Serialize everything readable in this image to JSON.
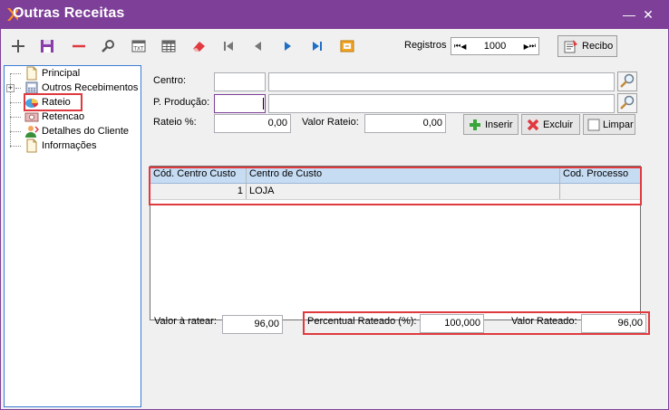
{
  "window": {
    "title": "Outras Receitas",
    "accent": "#7d3f98",
    "minimize_glyph": "—",
    "close_glyph": "✕"
  },
  "toolbar": {
    "buttons": [
      "add-icon",
      "save-icon",
      "delete-icon",
      "search-icon",
      "export-txt-icon",
      "grid-icon",
      "eraser-icon",
      "first-record-icon",
      "previous-record-icon",
      "next-record-icon",
      "last-record-icon",
      "exit-icon"
    ],
    "registros_label": "Registros",
    "registros_value": "1000",
    "recibo_label": "Recibo"
  },
  "tree": {
    "items": [
      {
        "label": "Principal",
        "icon": "document-icon"
      },
      {
        "label": "Outros Recebimentos",
        "icon": "calculator-icon",
        "expandable": true,
        "expander": "+"
      },
      {
        "label": "Rateio",
        "icon": "pie-chart-icon",
        "selected": true
      },
      {
        "label": "Retencao",
        "icon": "money-icon"
      },
      {
        "label": "Detalhes do Cliente",
        "icon": "user-icon"
      },
      {
        "label": "Informações",
        "icon": "document-icon"
      }
    ]
  },
  "form": {
    "centro_label": "Centro:",
    "centro_code": "",
    "centro_desc": "",
    "producao_label": "P. Produção:",
    "producao_code": "",
    "producao_desc": "",
    "rateio_pct_label": "Rateio %:",
    "rateio_pct_value": "0,00",
    "valor_rateio_label": "Valor Rateio:",
    "valor_rateio_value": "0,00",
    "inserir_label": "Inserir",
    "excluir_label": "Excluir",
    "limpar_label": "Limpar"
  },
  "grid": {
    "columns": [
      "Cód. Centro Custo",
      "Centro de Custo",
      "Cod. Processo"
    ],
    "rows": [
      {
        "codigo": "1",
        "centro": "LOJA",
        "processo": ""
      }
    ]
  },
  "footer": {
    "valor_ratear_label": "Valor à ratear:",
    "valor_ratear_value": "96,00",
    "percentual_label": "Percentual Rateado (%):",
    "percentual_value": "100,000",
    "valor_rateado_label": "Valor Rateado:",
    "valor_rateado_value": "96,00"
  },
  "colors": {
    "highlight": "#e0393e",
    "grid_header": "#c6dcf3",
    "tree_border": "#3d7bd3"
  }
}
